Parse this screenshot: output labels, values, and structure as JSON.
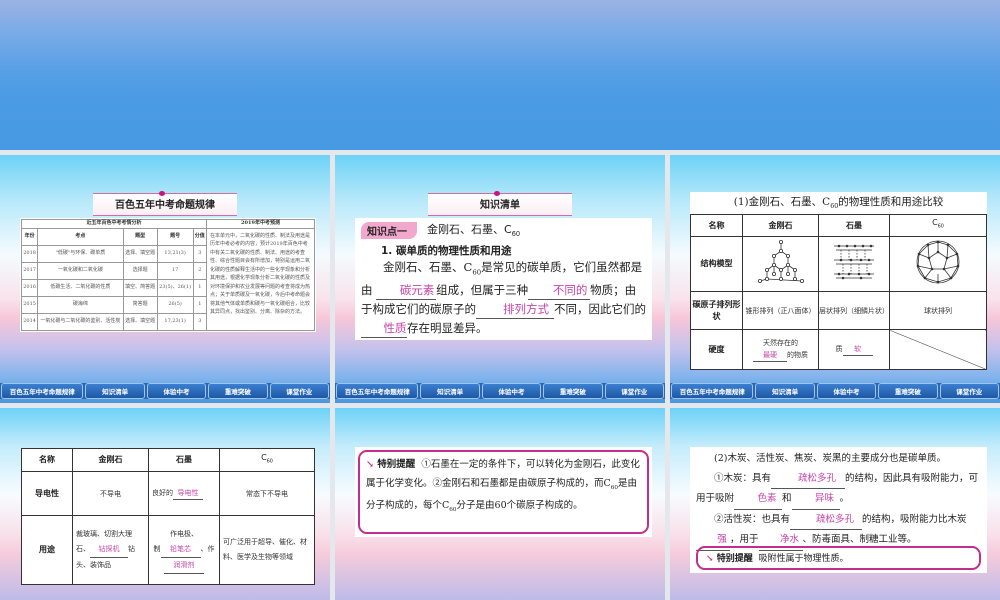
{
  "nav": [
    "百色五年中考命题规律",
    "知识清单",
    "体验中考",
    "重难突破",
    "课堂作业"
  ],
  "s1": {
    "title": "百色五年中考命题规律",
    "table_title": "近五年百色中考考情分析",
    "predict_title": "2019年中考预测",
    "headers": [
      "年份",
      "考点",
      "题型",
      "题号",
      "分值"
    ],
    "rows": [
      [
        "2018",
        "\"低碳\"与环保、碳单质",
        "选择、填空题",
        "13,21(3)",
        "3"
      ],
      [
        "2017",
        "一氧化碳和二氧化碳",
        "选择题",
        "17",
        "2"
      ],
      [
        "2016",
        "低碳生活、二氧化碳的性质",
        "填空、简答题",
        "23(5)、26(1)",
        "1"
      ],
      [
        "2015",
        "碳海绵",
        "简答题",
        "26(5)",
        "1"
      ],
      [
        "2014",
        "一氧化碳与二氧化碳的鉴别、活性炭",
        "选择、填空题",
        "17,23(1)",
        "3"
      ]
    ],
    "predict": "在本单元中，二氧化碳的性质、制法及用途是历年中考必考的内容，预计2019年百色中考中有关二氧化碳的性质、制法、用途的考查性、综合性题目会有所增加，特别是运用二氧化碳的性质解释生活中的一些化学现象和分析其用途，根据化学现象分析二氧化碳的性质及对环境保护和农业发展等问题的考查将成为热点；关于单质碳及一氧化碳，今后中考命题会将其他气体或单质和碳与一氧化碳组合，比较其异同点，找出鉴别、分离、除杂的方法。"
  },
  "s2": {
    "title": "知识清单",
    "tag": "知识点一",
    "topic": "金刚石、石墨、C",
    "topic_sub": "60",
    "heading": "1. 碳单质的物理性质和用途",
    "p1": "金刚石、石墨、C",
    "p1_sub": "60",
    "p2": "是常见的碳单质，它们虽然都是由",
    "b1": "碳元素",
    "p3": "组成，但属于三种",
    "b2": "不同的",
    "p4": "物质；由于构成它们的碳原子的",
    "b3": "排列方式",
    "p5": "不同，因此它们的",
    "b4": "性质",
    "p6": "存在明显差异。"
  },
  "s3": {
    "title": "(1)金刚石、石墨、C",
    "title_sub": "60",
    "title_end": "的物理性质和用途比较",
    "headers": [
      "名称",
      "金刚石",
      "石墨",
      "C"
    ],
    "c60_sub": "60",
    "row_labels": [
      "结构模型",
      "碳原子排列形状",
      "硬度"
    ],
    "arrangement": [
      "锥形排列（正八面体）",
      "层状排列（细鳞片状）",
      "球状排列"
    ],
    "hard_a": "天然存在的",
    "hard_b": "最硬",
    "hard_c": "的物质",
    "graphite_a": "质",
    "graphite_b": "软"
  },
  "s4": {
    "headers": [
      "名称",
      "金刚石",
      "石墨",
      "C"
    ],
    "c60_sub": "60",
    "row_labels": [
      "导电性",
      "用途"
    ],
    "cond": [
      "不导电",
      "良好的",
      "导电性",
      "常态下不导电"
    ],
    "use_d": [
      "裁玻璃、切割大理石、",
      "钻探机",
      "钻头、装饰品"
    ],
    "use_g": [
      "作电极、",
      "制",
      "铅笔芯",
      "、作",
      "润滑剂"
    ],
    "use_c": "可广泛用于超导、催化、材料、医学及生物等领域"
  },
  "s5": {
    "label": "特别提醒",
    "t1": "①石墨在一定的条件下，可以转化为金刚石，此变化属于化学变化。②金刚石和石墨都是由碳原子构成的，而C",
    "t1_sub": "60",
    "t2": "是由分子构成的，每个C",
    "t2_sub": "60",
    "t3": "分子是由60个碳原子构成的。"
  },
  "s6": {
    "intro": "(2)木炭、活性炭、焦炭、炭黑的主要成分也是碳单质。",
    "a1": "①木炭：具有",
    "b1": "疏松多孔",
    "a2": "的结构，因此具有吸附能力，可用于吸附",
    "b2": "色素",
    "a3": "和",
    "b3": "异味",
    "a4": "。",
    "c1": "②活性炭：也具有",
    "b4": "疏松多孔",
    "c2": "的结构，吸附能力比木炭",
    "b5": "强",
    "c3": "，用于",
    "b6": "净水",
    "c4": "、防毒面具、制糖工业等。",
    "tip_label": "特别提醒",
    "tip": "吸附性属于物理性质。"
  },
  "colors": {
    "accent": "#c32e8a",
    "blank": "#c844a8",
    "nav": "#1d58a4"
  }
}
